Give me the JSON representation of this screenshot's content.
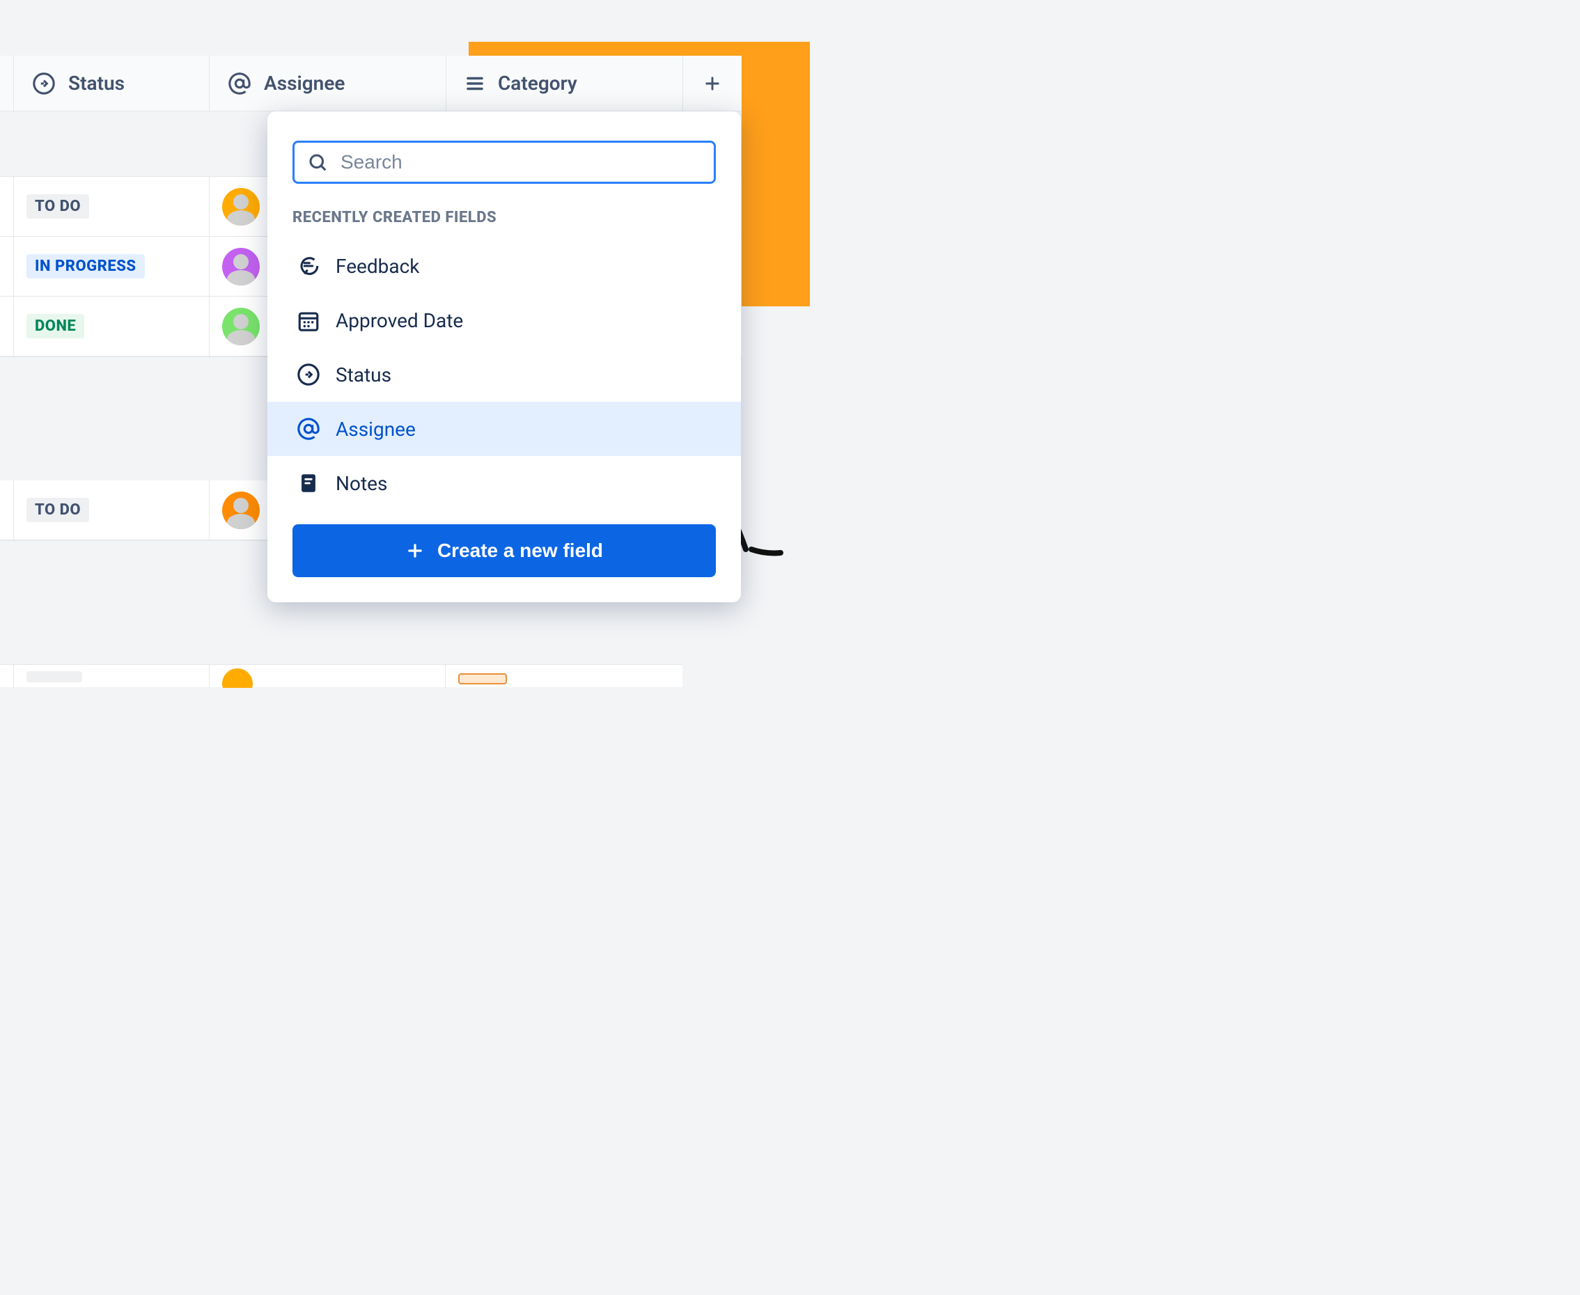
{
  "columns": {
    "status": "Status",
    "assignee": "Assignee",
    "category": "Category"
  },
  "rows_group1": [
    {
      "status_label": "TO DO",
      "status_class": "todo",
      "avatar_color": "c1"
    },
    {
      "status_label": "IN PROGRESS",
      "status_class": "inprogress",
      "avatar_color": "c2"
    },
    {
      "status_label": "DONE",
      "status_class": "done",
      "avatar_color": "c3"
    }
  ],
  "rows_group2": [
    {
      "status_label": "TO DO",
      "status_class": "todo",
      "avatar_color": "c4"
    }
  ],
  "dropdown": {
    "search_placeholder": "Search",
    "section_label": "RECENTLY CREATED FIELDS",
    "options": [
      {
        "label": "Feedback",
        "icon": "feedback-icon",
        "highlighted": false
      },
      {
        "label": "Approved Date",
        "icon": "calendar-icon",
        "highlighted": false
      },
      {
        "label": "Status",
        "icon": "status-icon",
        "highlighted": false
      },
      {
        "label": "Assignee",
        "icon": "mention-icon",
        "highlighted": true
      },
      {
        "label": "Notes",
        "icon": "notes-icon",
        "highlighted": false
      }
    ],
    "create_button_label": "Create a new field"
  }
}
